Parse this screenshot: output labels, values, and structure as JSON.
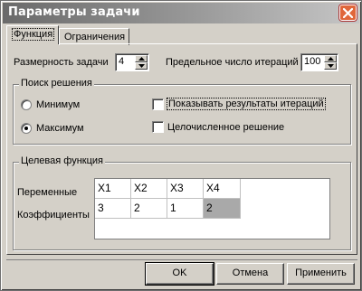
{
  "window": {
    "title": "Параметры задачи"
  },
  "tabs": [
    {
      "label": "Функция",
      "active": true
    },
    {
      "label": "Ограничения",
      "active": false
    }
  ],
  "dimension": {
    "label": "Размерность задачи",
    "value": "4"
  },
  "iterations": {
    "label": "Предельное число итераций",
    "value": "100"
  },
  "search": {
    "title": "Поиск решения",
    "minimum_label": "Минимум",
    "maximum_label": "Максимум",
    "selected": "maximum",
    "show_iterations_label": "Показывать результаты итераций",
    "show_iterations_checked": false,
    "integer_label": "Целочисленное решение",
    "integer_checked": false
  },
  "objective": {
    "title": "Целевая функция",
    "variables_label": "Переменные",
    "coefficients_label": "Коэффициенты",
    "variables": [
      "X1",
      "X2",
      "X3",
      "X4"
    ],
    "coefficients": [
      "3",
      "2",
      "1",
      "2"
    ]
  },
  "buttons": {
    "ok": "OK",
    "cancel": "Отмена",
    "apply": "Применить"
  },
  "colors": {
    "dialog_bg": "#d4d0c8",
    "close_button": "#e0673b",
    "selected_cell": "#a9a9a9"
  }
}
